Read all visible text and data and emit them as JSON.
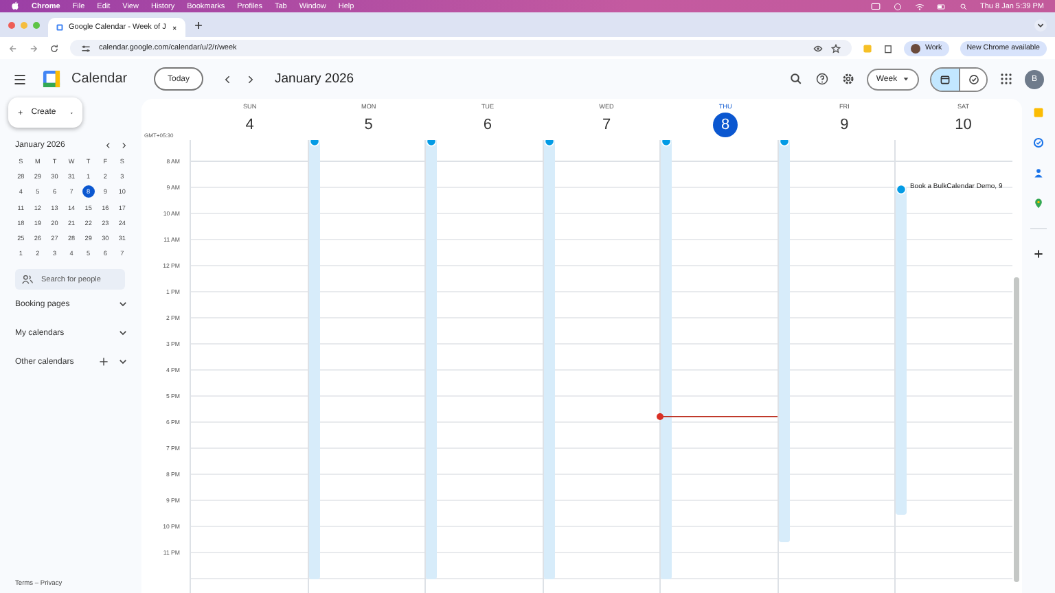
{
  "menu_bar": {
    "app": "Chrome",
    "items": [
      "File",
      "Edit",
      "View",
      "History",
      "Bookmarks",
      "Profiles",
      "Tab",
      "Window",
      "Help"
    ],
    "clock": "Thu 8 Jan  5:39 PM"
  },
  "browser": {
    "tab_title": "Google Calendar - Week of J",
    "address": "calendar.google.com/calendar/u/2/r/week",
    "profile": "Work",
    "update_chip": "New Chrome available"
  },
  "header": {
    "app_name": "Calendar",
    "today_button": "Today",
    "period": "January 2026",
    "view": "Week",
    "mode_toggle": [
      {
        "kind": "calendar",
        "selected": true
      },
      {
        "kind": "tasks",
        "selected": false
      }
    ],
    "avatar": "B"
  },
  "sidebar": {
    "create": "Create",
    "mini_calendar": {
      "title": "January 2026",
      "weekdays": [
        "S",
        "M",
        "T",
        "W",
        "T",
        "F",
        "S"
      ],
      "weeks": [
        [
          {
            "d": "28",
            "selected": false
          },
          {
            "d": "29",
            "selected": false
          },
          {
            "d": "30",
            "selected": false
          },
          {
            "d": "31",
            "selected": false
          },
          {
            "d": "1",
            "selected": false
          },
          {
            "d": "2",
            "selected": false
          },
          {
            "d": "3",
            "selected": false
          }
        ],
        [
          {
            "d": "4",
            "selected": false
          },
          {
            "d": "5",
            "selected": false
          },
          {
            "d": "6",
            "selected": false
          },
          {
            "d": "7",
            "selected": false
          },
          {
            "d": "8",
            "selected": true
          },
          {
            "d": "9",
            "selected": false
          },
          {
            "d": "10",
            "selected": false
          }
        ],
        [
          {
            "d": "11",
            "selected": false
          },
          {
            "d": "12",
            "selected": false
          },
          {
            "d": "13",
            "selected": false
          },
          {
            "d": "14",
            "selected": false
          },
          {
            "d": "15",
            "selected": false
          },
          {
            "d": "16",
            "selected": false
          },
          {
            "d": "17",
            "selected": false
          }
        ],
        [
          {
            "d": "18",
            "selected": false
          },
          {
            "d": "19",
            "selected": false
          },
          {
            "d": "20",
            "selected": false
          },
          {
            "d": "21",
            "selected": false
          },
          {
            "d": "22",
            "selected": false
          },
          {
            "d": "23",
            "selected": false
          },
          {
            "d": "24",
            "selected": false
          }
        ],
        [
          {
            "d": "25",
            "selected": false
          },
          {
            "d": "26",
            "selected": false
          },
          {
            "d": "27",
            "selected": false
          },
          {
            "d": "28",
            "selected": false
          },
          {
            "d": "29",
            "selected": false
          },
          {
            "d": "30",
            "selected": false
          },
          {
            "d": "31",
            "selected": false
          }
        ],
        [
          {
            "d": "1",
            "selected": false
          },
          {
            "d": "2",
            "selected": false
          },
          {
            "d": "3",
            "selected": false
          },
          {
            "d": "4",
            "selected": false
          },
          {
            "d": "5",
            "selected": false
          },
          {
            "d": "6",
            "selected": false
          },
          {
            "d": "7",
            "selected": false
          }
        ]
      ]
    },
    "search_placeholder": "Search for people",
    "sections": [
      {
        "label": "Booking pages",
        "addable": false
      },
      {
        "label": "My calendars",
        "addable": false
      },
      {
        "label": "Other calendars",
        "addable": true
      }
    ],
    "footer": "Terms – Privacy"
  },
  "week": {
    "timezone": "GMT+05:30",
    "hours": [
      "8 AM",
      "9 AM",
      "10 AM",
      "11 AM",
      "12 PM",
      "1 PM",
      "2 PM",
      "3 PM",
      "4 PM",
      "5 PM",
      "6 PM",
      "7 PM",
      "8 PM",
      "9 PM",
      "10 PM",
      "11 PM"
    ],
    "days": [
      {
        "dow": "SUN",
        "date": "4",
        "selected": false,
        "has_event": false
      },
      {
        "dow": "MON",
        "date": "5",
        "selected": false,
        "has_event": true
      },
      {
        "dow": "TUE",
        "date": "6",
        "selected": false,
        "has_event": true
      },
      {
        "dow": "WED",
        "date": "7",
        "selected": false,
        "has_event": true
      },
      {
        "dow": "THU",
        "date": "8",
        "selected": true,
        "has_event": true
      },
      {
        "dow": "FRI",
        "date": "9",
        "selected": false,
        "has_event": true
      },
      {
        "dow": "SAT",
        "date": "10",
        "selected": false,
        "has_event": true,
        "event_title": "Book a BulkCalendar Demo, 9"
      }
    ]
  }
}
